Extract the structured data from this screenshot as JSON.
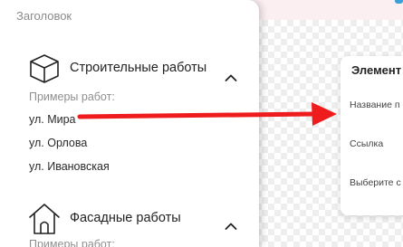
{
  "panel": {
    "title": "Заголовок",
    "sections": [
      {
        "title": "Строительные работы",
        "icon": "cube-icon",
        "examples_label": "Примеры работ:",
        "items": [
          "ул. Мира",
          "ул. Орлова",
          "ул. Ивановская"
        ],
        "expanded": true
      },
      {
        "title": "Фасадные работы",
        "icon": "house-icon",
        "examples_label": "Примеры работ:"
      }
    ]
  },
  "card": {
    "title": "Элемент",
    "fields": [
      "Название п",
      "Ссылка",
      "Выберите с"
    ]
  },
  "colors": {
    "arrow": "#ee1c1c",
    "accent": "#3aa0d8",
    "top_strip": "#fbeff1"
  }
}
